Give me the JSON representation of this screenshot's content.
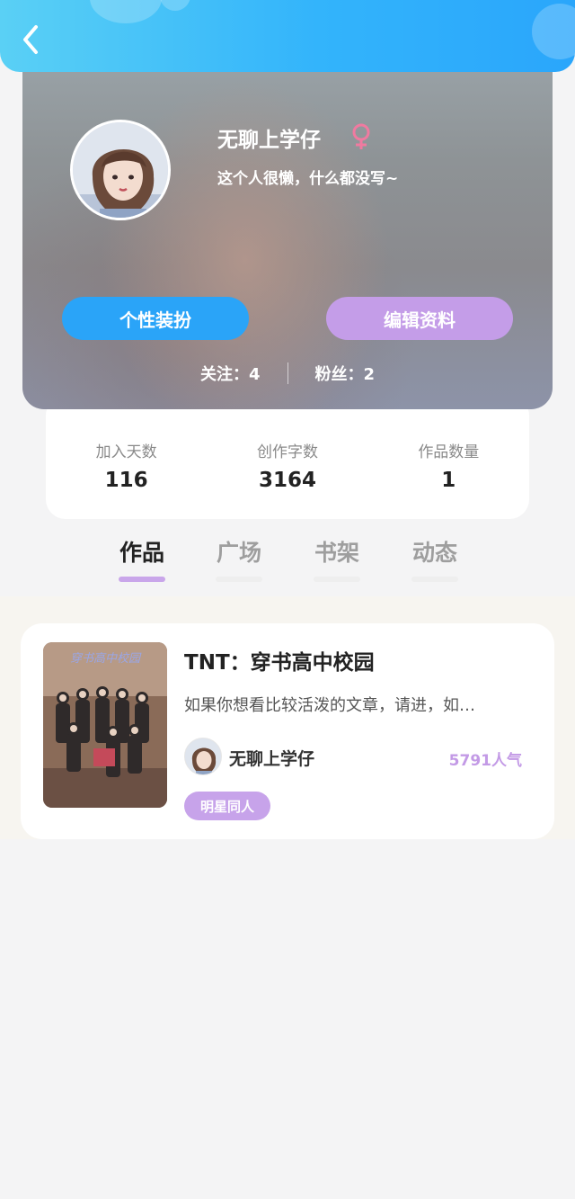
{
  "header": {
    "back_icon": "chevron-left-icon"
  },
  "profile": {
    "username": "无聊上学仔",
    "gender_icon": "female-symbol-icon",
    "bio": "这个人很懒，什么都没写~",
    "buttons": {
      "dress_up": "个性装扮",
      "edit_profile": "编辑资料"
    },
    "following": "关注：4",
    "followers": "粉丝：2"
  },
  "stats": [
    {
      "label": "加入天数",
      "value": "116"
    },
    {
      "label": "创作字数",
      "value": "3164"
    },
    {
      "label": "作品数量",
      "value": "1"
    }
  ],
  "tabs": [
    {
      "label": "作品",
      "active": true
    },
    {
      "label": "广场",
      "active": false
    },
    {
      "label": "书架",
      "active": false
    },
    {
      "label": "动态",
      "active": false
    }
  ],
  "works": [
    {
      "title": "TNT：穿书高中校园",
      "description": "如果你想看比较活泼的文章，请进，如…",
      "author": "无聊上学仔",
      "popularity": "5791人气",
      "tag": "明星同人",
      "cover_caption": "穿书高中校园"
    }
  ],
  "colors": {
    "header_blue": "#33b4fb",
    "accent_blue": "#2aa4f8",
    "accent_purple": "#c49de8",
    "gender_pink": "#f07aa0"
  }
}
